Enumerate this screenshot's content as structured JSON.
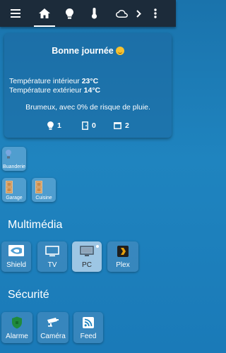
{
  "nav": {
    "tabs": [
      {
        "name": "menu",
        "icon": "menu-icon"
      },
      {
        "name": "home",
        "icon": "home-icon",
        "active": true
      },
      {
        "name": "lights",
        "icon": "lightbulb-icon"
      },
      {
        "name": "temperature",
        "icon": "thermometer-icon"
      },
      {
        "name": "weather",
        "icon": "cloud-icon"
      },
      {
        "name": "more-tabs",
        "icon": "chevron-right-icon"
      },
      {
        "name": "overflow",
        "icon": "more-vertical-icon"
      }
    ]
  },
  "summary": {
    "greeting": "Bonne journée",
    "indoor_label": "Température intérieur",
    "indoor_value": "23°C",
    "outdoor_label": "Température extérieur",
    "outdoor_value": "14°C",
    "weather_text": "Brumeux, avec 0% de risque de pluie.",
    "lights_on": "1",
    "doors_open": "0",
    "windows_open": "2"
  },
  "rooms": {
    "items": [
      {
        "label": "Buanderie",
        "icon": "lightbulb-icon"
      },
      {
        "label": "Garage",
        "icon": "door-icon"
      },
      {
        "label": "Cuisine",
        "icon": "door-icon"
      }
    ]
  },
  "multimedia": {
    "title": "Multimédia",
    "items": [
      {
        "label": "Shield",
        "icon": "nvidia-icon"
      },
      {
        "label": "TV",
        "icon": "tv-icon"
      },
      {
        "label": "PC",
        "icon": "monitor-icon",
        "active": true
      },
      {
        "label": "Plex",
        "icon": "plex-icon"
      }
    ]
  },
  "security": {
    "title": "Sécurité",
    "items": [
      {
        "label": "Alarme",
        "icon": "shield-icon"
      },
      {
        "label": "Caméra",
        "icon": "camera-icon"
      },
      {
        "label": "Feed",
        "icon": "rss-icon"
      }
    ]
  },
  "colors": {
    "topbar": "#1c2b3a",
    "background": "#1f84bf",
    "alarm_green": "#1f8a3c",
    "plex_orange": "#e5a00d",
    "bulb_lit": "#7aa7e0"
  }
}
